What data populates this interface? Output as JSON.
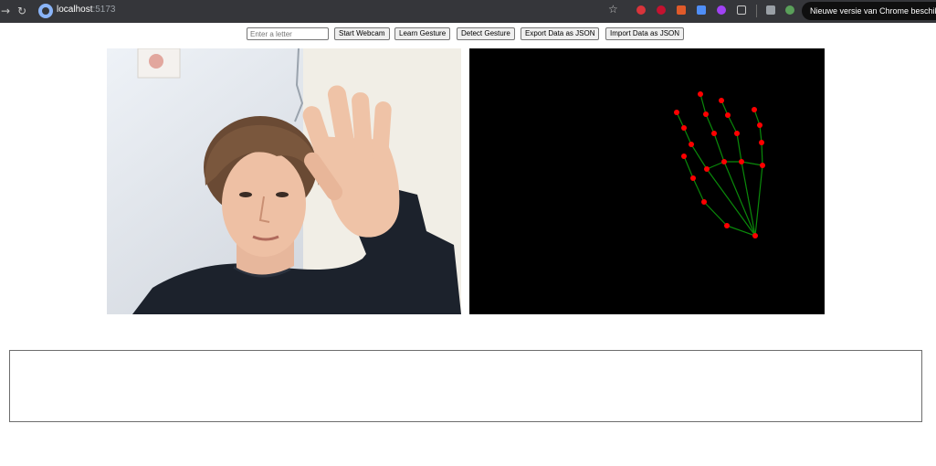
{
  "browser": {
    "url_host": "localhost",
    "url_port": ":5173",
    "update_notice": "Nieuwe versie van Chrome beschikbaar"
  },
  "toolbar": {
    "letter_placeholder": "Enter a letter",
    "start_webcam": "Start Webcam",
    "learn_gesture": "Learn Gesture",
    "detect_gesture": "Detect Gesture",
    "export_json": "Export Data as JSON",
    "import_json": "Import Data as JSON"
  },
  "colors": {
    "landmark": "#ff0000",
    "connection": "#008000",
    "canvas_bg": "#000000"
  },
  "icons": [
    "back-arrow-icon",
    "reload-icon",
    "site-info-icon",
    "star-icon",
    "extension-icon",
    "puzzle-icon"
  ],
  "output": {
    "text": ""
  }
}
